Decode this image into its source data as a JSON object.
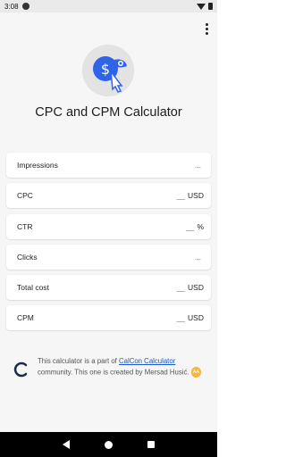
{
  "status_bar": {
    "time": "3:08"
  },
  "app": {
    "title": "CPC and CPM Calculator",
    "fields": [
      {
        "label": "Impressions",
        "value": "...",
        "unit": ""
      },
      {
        "label": "CPC",
        "value": "__",
        "unit": "USD"
      },
      {
        "label": "CTR",
        "value": "__",
        "unit": "%"
      },
      {
        "label": "Clicks",
        "value": "...",
        "unit": ""
      },
      {
        "label": "Total cost",
        "value": "__",
        "unit": "USD"
      },
      {
        "label": "CPM",
        "value": "__",
        "unit": "USD"
      }
    ],
    "footer": {
      "text_before": "This calculator is a part of ",
      "link": "CalCon Calculator",
      "text_after": " community. This one is created by Mersad Husić.",
      "badge": "AA"
    }
  },
  "colors": {
    "accent": "#1a56c9",
    "logo_bg": "#e3e3e3",
    "badge": "#f5b642"
  },
  "icons": [
    "overflow-menu-icon",
    "calculator-logo-icon",
    "calcon-brand-icon",
    "back-icon",
    "home-icon",
    "recents-icon"
  ]
}
